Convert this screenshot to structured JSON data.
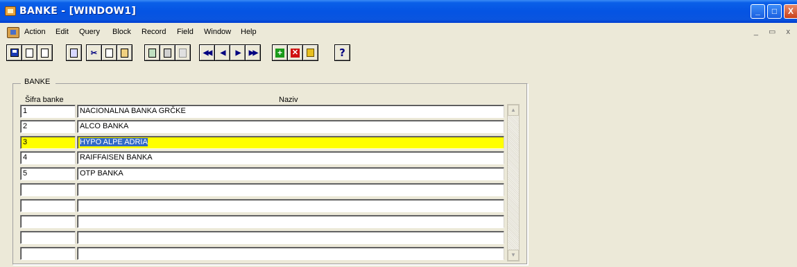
{
  "window": {
    "title": "BANKE  - [WINDOW1]",
    "controls": {
      "minimize": "_",
      "maximize": "□",
      "close": "X"
    }
  },
  "menu": {
    "items": [
      "Action",
      "Edit",
      "Query",
      "Block",
      "Record",
      "Field",
      "Window",
      "Help"
    ],
    "mdi_controls": "_ ▭ x"
  },
  "toolbar": {
    "icons": [
      "save-icon",
      "print-icon",
      "exit-icon",
      "cut-icon",
      "copy-icon",
      "paste-icon",
      "query-icon",
      "execute-query-icon",
      "cancel-query-icon",
      "first-record-icon",
      "previous-record-icon",
      "next-record-icon",
      "last-record-icon",
      "insert-record-icon",
      "delete-record-icon",
      "lock-record-icon",
      "help-icon"
    ]
  },
  "block": {
    "title": "BANKE",
    "columns": {
      "id": "Šifra banke",
      "name": "Naziv"
    },
    "rows": [
      {
        "id": "1",
        "name": "NACIONALNA BANKA GRČKE"
      },
      {
        "id": "2",
        "name": "ALCO BANKA"
      },
      {
        "id": "3",
        "name": "HYPO ALPE ADRIA"
      },
      {
        "id": "4",
        "name": "RAIFFAISEN BANKA"
      },
      {
        "id": "5",
        "name": "OTP BANKA"
      },
      {
        "id": "",
        "name": ""
      },
      {
        "id": "",
        "name": ""
      },
      {
        "id": "",
        "name": ""
      },
      {
        "id": "",
        "name": ""
      },
      {
        "id": "",
        "name": ""
      }
    ],
    "selected_row": 3
  },
  "colors": {
    "titlebar": "#0554e3",
    "selected_row": "#ffff00",
    "selection_highlight": "#3169c6",
    "background": "#ece9d8"
  }
}
